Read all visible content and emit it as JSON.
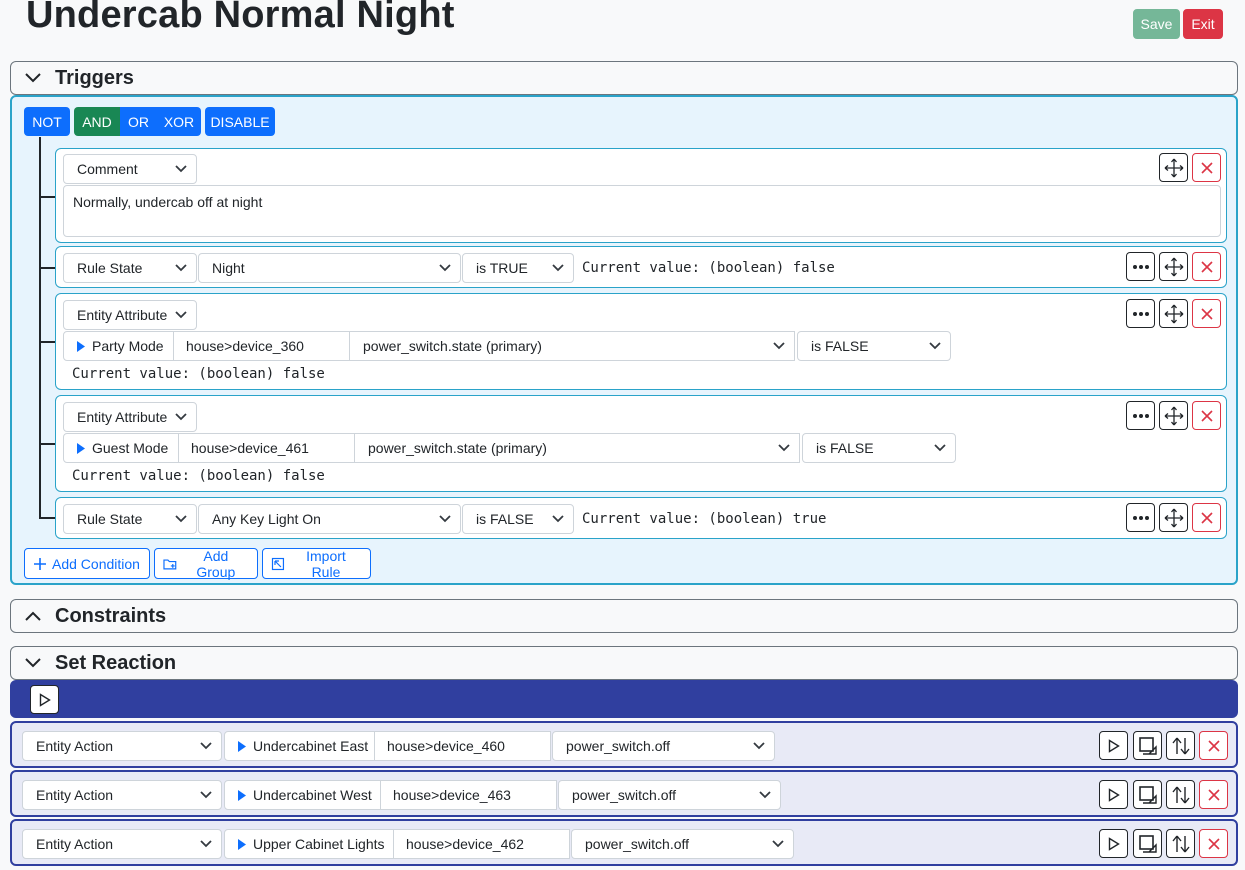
{
  "page": {
    "title": "Undercab Normal Night",
    "save_label": "Save",
    "exit_label": "Exit"
  },
  "sections": {
    "triggers": "Triggers",
    "constraints": "Constraints",
    "reaction": "Set Reaction"
  },
  "logic": {
    "not": "NOT",
    "and": "AND",
    "or": "OR",
    "xor": "XOR",
    "disable": "DISABLE"
  },
  "colors": {
    "primary": "#0d6efd",
    "success": "#198754",
    "danger": "#dc3545",
    "indigo": "#303f9f",
    "teal": "#2aa3c9"
  },
  "conditions": {
    "comment": {
      "type": "Comment",
      "text": "Normally, undercab off at night"
    },
    "rule1": {
      "type": "Rule State",
      "rule": "Night",
      "op": "is TRUE",
      "current": "Current value: (boolean) false"
    },
    "ea1": {
      "type": "Entity Attribute",
      "entity": "Party Mode",
      "device": "house>device_360",
      "attr": "power_switch.state (primary)",
      "op": "is FALSE",
      "current": "Current value: (boolean) false"
    },
    "ea2": {
      "type": "Entity Attribute",
      "entity": "Guest Mode",
      "device": "house>device_461",
      "attr": "power_switch.state (primary)",
      "op": "is FALSE",
      "current": "Current value: (boolean) false"
    },
    "rule2": {
      "type": "Rule State",
      "rule": "Any Key Light On",
      "op": "is FALSE",
      "current": "Current value: (boolean) true"
    }
  },
  "add_buttons": {
    "condition": "Add Condition",
    "group": "Add Group",
    "import": "Import Rule"
  },
  "actions": [
    {
      "type": "Entity Action",
      "entity": "Undercabinet East",
      "device": "house>device_460",
      "action": "power_switch.off"
    },
    {
      "type": "Entity Action",
      "entity": "Undercabinet West",
      "device": "house>device_463",
      "action": "power_switch.off"
    },
    {
      "type": "Entity Action",
      "entity": "Upper Cabinet Lights",
      "device": "house>device_462",
      "action": "power_switch.off"
    }
  ]
}
